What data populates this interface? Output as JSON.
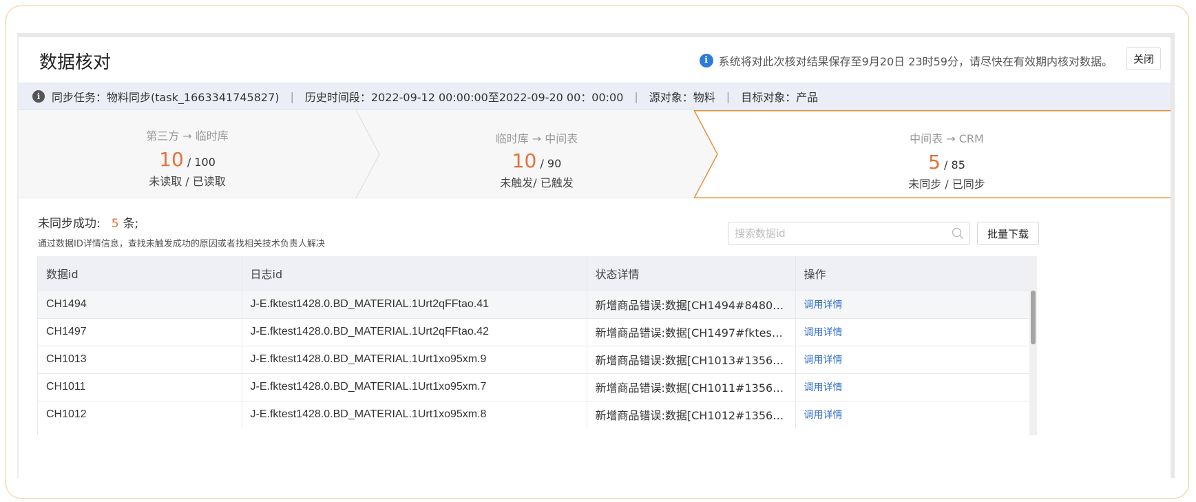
{
  "header": {
    "title": "数据核对",
    "notice": "系统将对此次核对结果保存至9月20日 23时59分，请尽快在有效期内核对数据。",
    "close_label": "关闭"
  },
  "task_bar": {
    "task": "同步任务：物料同步(task_1663341745827)",
    "period": "历史时间段：2022-09-12 00:00:00至2022-09-20 00：00:00",
    "source": "源对象：物料",
    "target": "目标对象：产品"
  },
  "steps": [
    {
      "label": "第三方 → 临时库",
      "count": "10",
      "total": " / 100",
      "sub": "未读取 / 已读取"
    },
    {
      "label": "临时库 → 中间表",
      "count": "10",
      "total": " / 90",
      "sub": "未触发/ 已触发"
    },
    {
      "label": "中间表 → CRM",
      "count": "5",
      "total": " / 85",
      "sub": "未同步 / 已同步"
    }
  ],
  "summary": {
    "label": "未同步成功:",
    "count": "5",
    "unit": "条;",
    "hint": "通过数据ID详情信息，查找未触发成功的原因或者找相关技术负责人解决"
  },
  "search": {
    "placeholder": "搜索数据id"
  },
  "batch_download_label": "批量下载",
  "table": {
    "columns": [
      "数据id",
      "日志id",
      "状态详情",
      "操作"
    ],
    "rows": [
      {
        "id": "CH1494",
        "log": "J-E.fktest1428.0.BD_MATERIAL.1Urt2qFFtao.41",
        "status": "新增商品错误:数据[CH1494#8480…",
        "action": "调用详情"
      },
      {
        "id": "CH1497",
        "log": "J-E.fktest1428.0.BD_MATERIAL.1Urt2qFFtao.42",
        "status": "新增商品错误:数据[CH1497#fktes…",
        "action": "调用详情"
      },
      {
        "id": "CH1013",
        "log": "J-E.fktest1428.0.BD_MATERIAL.1Urt1xo95xm.9",
        "status": "新增商品错误:数据[CH1013#1356…",
        "action": "调用详情"
      },
      {
        "id": "CH1011",
        "log": "J-E.fktest1428.0.BD_MATERIAL.1Urt1xo95xm.7",
        "status": "新增商品错误:数据[CH1011#1356…",
        "action": "调用详情"
      },
      {
        "id": "CH1012",
        "log": "J-E.fktest1428.0.BD_MATERIAL.1Urt1xo95xm.8",
        "status": "新增商品错误:数据[CH1012#1356…",
        "action": "调用详情"
      }
    ]
  },
  "colors": {
    "accent": "#e8703a",
    "link": "#2f6ec8",
    "info": "#2f7bdc"
  }
}
